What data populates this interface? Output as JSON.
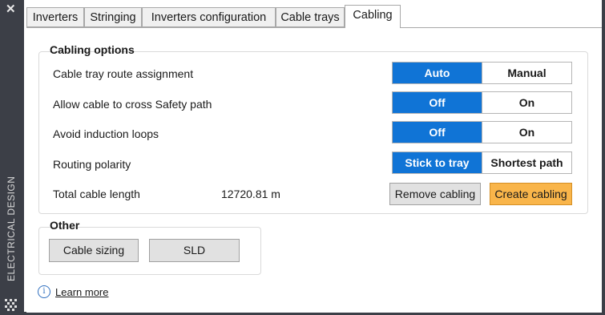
{
  "sidebar": {
    "close_glyph": "✕",
    "title": "ELECTRICAL DESIGN",
    "grip_icon": "grip-icon"
  },
  "tabs": [
    {
      "label": "Inverters"
    },
    {
      "label": "Stringing"
    },
    {
      "label": "Inverters configuration"
    },
    {
      "label": "Cable trays"
    },
    {
      "label": "Cabling",
      "active": true
    }
  ],
  "cabling_options": {
    "title": "Cabling options",
    "route": {
      "label": "Cable tray route assignment",
      "options": [
        "Auto",
        "Manual"
      ],
      "selected": "Auto"
    },
    "safety": {
      "label": "Allow cable to cross Safety path",
      "options": [
        "Off",
        "On"
      ],
      "selected": "Off"
    },
    "induction": {
      "label": "Avoid induction loops",
      "options": [
        "Off",
        "On"
      ],
      "selected": "Off"
    },
    "polarity": {
      "label": "Routing polarity",
      "options": [
        "Stick to tray",
        "Shortest path"
      ],
      "selected": "Stick to tray"
    },
    "total": {
      "label": "Total cable length",
      "value": "12720.81 m"
    },
    "remove_label": "Remove cabling",
    "create_label": "Create cabling"
  },
  "other": {
    "title": "Other",
    "cable_sizing_label": "Cable sizing",
    "sld_label": "SLD"
  },
  "learn_more": {
    "icon": "info-icon",
    "glyph": "i",
    "label": "Learn more"
  },
  "colors": {
    "accent": "#1074d6",
    "create_button": "#f9b54a",
    "sidebar": "#3c3f47"
  }
}
